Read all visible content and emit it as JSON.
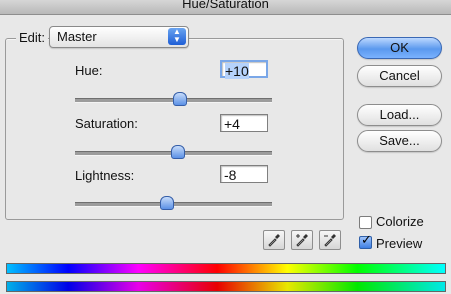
{
  "window": {
    "title": "Hue/Saturation"
  },
  "edit": {
    "label": "Edit:",
    "selected": "Master"
  },
  "controls": [
    {
      "label": "Hue:",
      "value": "+10",
      "min": -180,
      "max": 180,
      "amount": 10
    },
    {
      "label": "Saturation:",
      "value": "+4",
      "min": -100,
      "max": 100,
      "amount": 4
    },
    {
      "label": "Lightness:",
      "value": "-8",
      "min": -100,
      "max": 100,
      "amount": -8
    }
  ],
  "buttons": {
    "ok": "OK",
    "cancel": "Cancel",
    "load": "Load...",
    "save": "Save..."
  },
  "options": {
    "colorize_label": "Colorize",
    "colorize_checked": false,
    "preview_label": "Preview",
    "preview_checked": true
  },
  "icons": [
    "eyedropper-icon",
    "eyedropper-plus-icon",
    "eyedropper-minus-icon"
  ],
  "colors": {
    "accent": "#5b99ee"
  }
}
